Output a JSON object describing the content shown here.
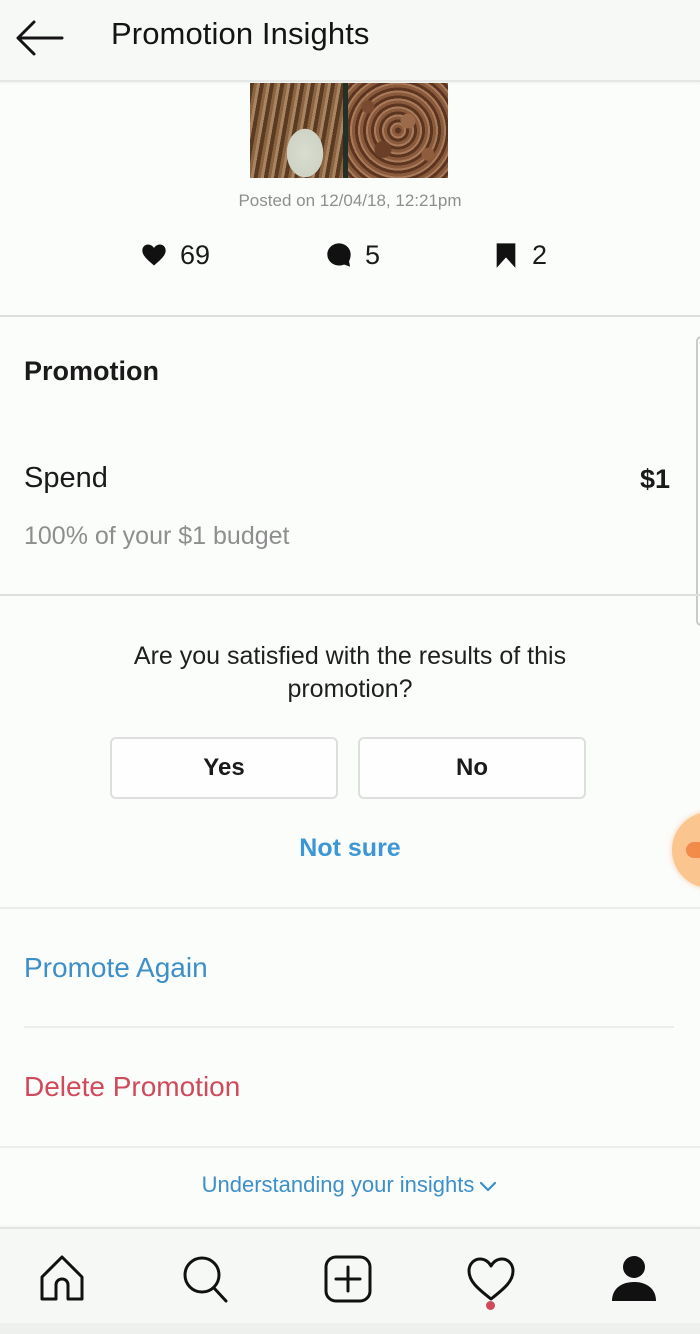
{
  "header": {
    "title": "Promotion Insights",
    "back_icon": "arrow-left-icon"
  },
  "post": {
    "thumbnail_alt": "Before/after curly hair photo",
    "posted_text": "Posted on 12/04/18, 12:21pm",
    "stats": {
      "likes": {
        "icon": "heart-filled-icon",
        "value": "69"
      },
      "comments": {
        "icon": "comment-filled-icon",
        "value": "5"
      },
      "saves": {
        "icon": "bookmark-filled-icon",
        "value": "2"
      }
    }
  },
  "promotion": {
    "section_title": "Promotion",
    "spend_label": "Spend",
    "spend_value": "$1",
    "spend_subtext": "100% of your $1 budget",
    "budget_used_percent": 100
  },
  "feedback": {
    "question": "Are you satisfied with the results of this promotion?",
    "yes_label": "Yes",
    "no_label": "No",
    "not_sure_label": "Not sure"
  },
  "actions": {
    "promote_again": "Promote Again",
    "delete_promotion": "Delete Promotion"
  },
  "footer": {
    "understanding_label": "Understanding your insights",
    "understanding_icon": "chevron-down-icon"
  },
  "bottom_nav": {
    "items": [
      {
        "name": "home",
        "icon": "home-icon"
      },
      {
        "name": "search",
        "icon": "search-icon"
      },
      {
        "name": "new-post",
        "icon": "plus-square-icon"
      },
      {
        "name": "activity",
        "icon": "heart-outline-icon",
        "has_notification": true
      },
      {
        "name": "profile",
        "icon": "profile-icon"
      }
    ]
  },
  "colors": {
    "link_blue": "#3d8fc8",
    "not_sure_blue": "#3d97d4",
    "delete_red": "#cf4a5a",
    "muted_text": "#8e8e8e",
    "floating_bubble": "#fbc58f"
  }
}
